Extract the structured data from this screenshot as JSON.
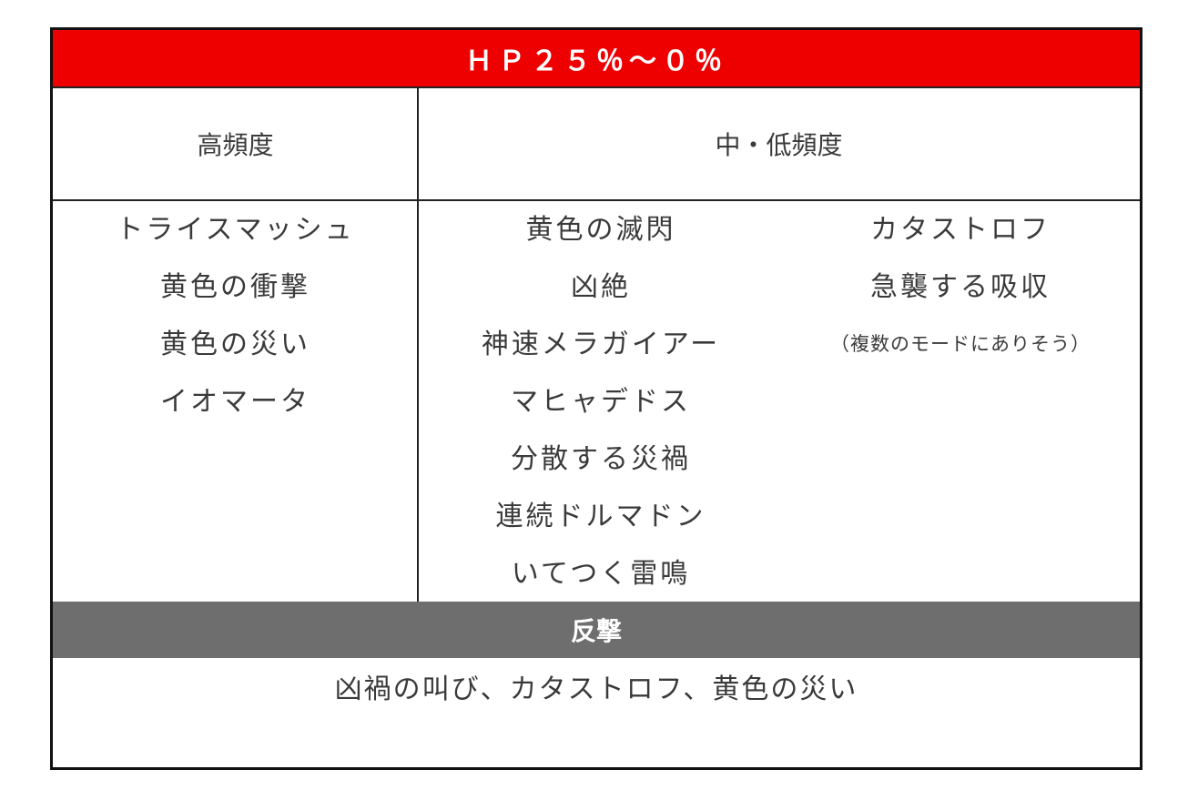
{
  "title": "ＨＰ２５％～０％",
  "headers": {
    "high": "高頻度",
    "mid_low": "中・低頻度"
  },
  "high_frequency": [
    "トライスマッシュ",
    "黄色の衝撃",
    "黄色の災い",
    "イオマータ"
  ],
  "mid_frequency": [
    "黄色の滅閃",
    "凶絶",
    "神速メラガイアー",
    "マヒャデドス",
    "分散する災禍",
    "連続ドルマドン",
    "いてつく雷鳴"
  ],
  "low_frequency": [
    "カタストロフ",
    "急襲する吸収",
    "（複数のモードにありそう）"
  ],
  "counter": {
    "label": "反撃",
    "text": "凶禍の叫び、カタストロフ、黄色の災い"
  },
  "colors": {
    "title_bar": "#ee0000",
    "counter_bar": "#6e6e6e",
    "border": "#111111"
  }
}
